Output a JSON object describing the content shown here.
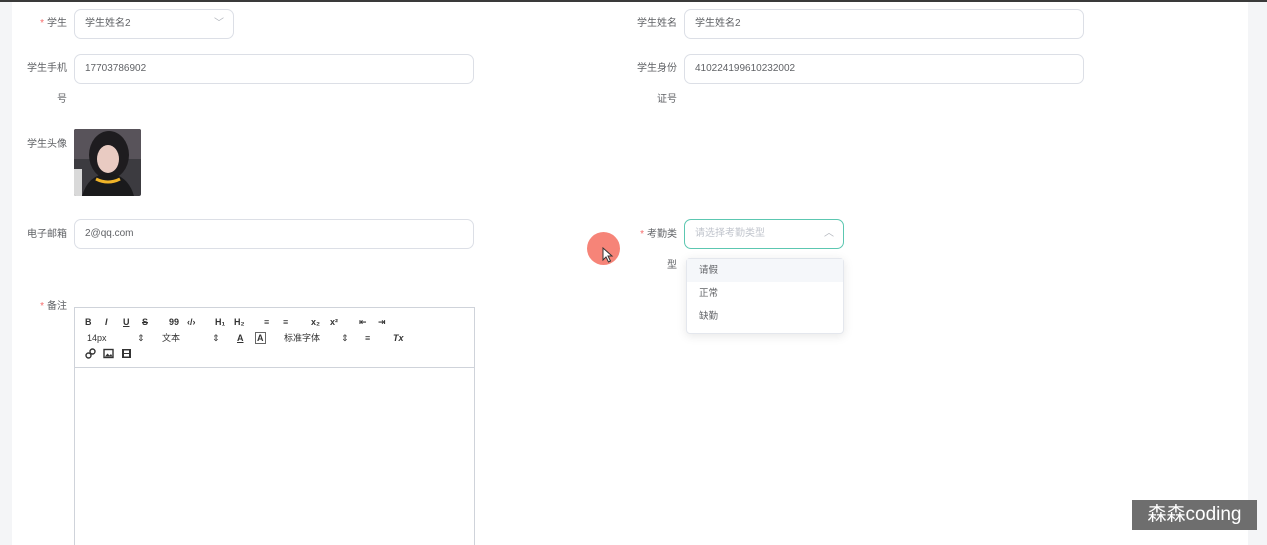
{
  "form": {
    "student": {
      "label": "学生",
      "value": "学生姓名2"
    },
    "student_name": {
      "label": "学生姓名",
      "value": "学生姓名2"
    },
    "phone": {
      "label_line1": "学生手机",
      "label_line2": "号",
      "value": "17703786902"
    },
    "id_card": {
      "label_line1": "学生身份",
      "label_line2": "证号",
      "value": "410224199610232002"
    },
    "avatar": {
      "label": "学生头像"
    },
    "email": {
      "label": "电子邮箱",
      "value": "2@qq.com"
    },
    "attendance_type": {
      "label_line1": "考勤类",
      "label_line2": "型",
      "placeholder": "请选择考勤类型"
    },
    "remark": {
      "label": "备注"
    }
  },
  "required_mark": "*",
  "dropdown": {
    "options": [
      "请假",
      "正常",
      "缺勤"
    ],
    "hovered_index": 0
  },
  "editor": {
    "toolbar": {
      "bold": "B",
      "italic": "I",
      "underline": "U",
      "strike": "S",
      "quote": "99",
      "code": "‹/›",
      "h1": "H₁",
      "h2": "H₂",
      "ordered_list": "≡",
      "bullet_list": "≡",
      "subscript": "x₂",
      "superscript": "x²",
      "indent_left": "⇤",
      "indent_right": "⇥",
      "font_size": "14px",
      "text_type": "文本",
      "font_family": "标准字体",
      "color": "A",
      "background": "A",
      "align": "≡",
      "clean": "Tx",
      "select_arrow": "⇕"
    }
  },
  "icons": {
    "select_arrow": "chevron-down-icon",
    "select_arrow_open": "chevron-up-icon"
  },
  "colors": {
    "focus_border": "#5cc7b1",
    "required": "#f56c6c",
    "cursor_highlight": "#f57a6c"
  },
  "watermark": "森森coding"
}
